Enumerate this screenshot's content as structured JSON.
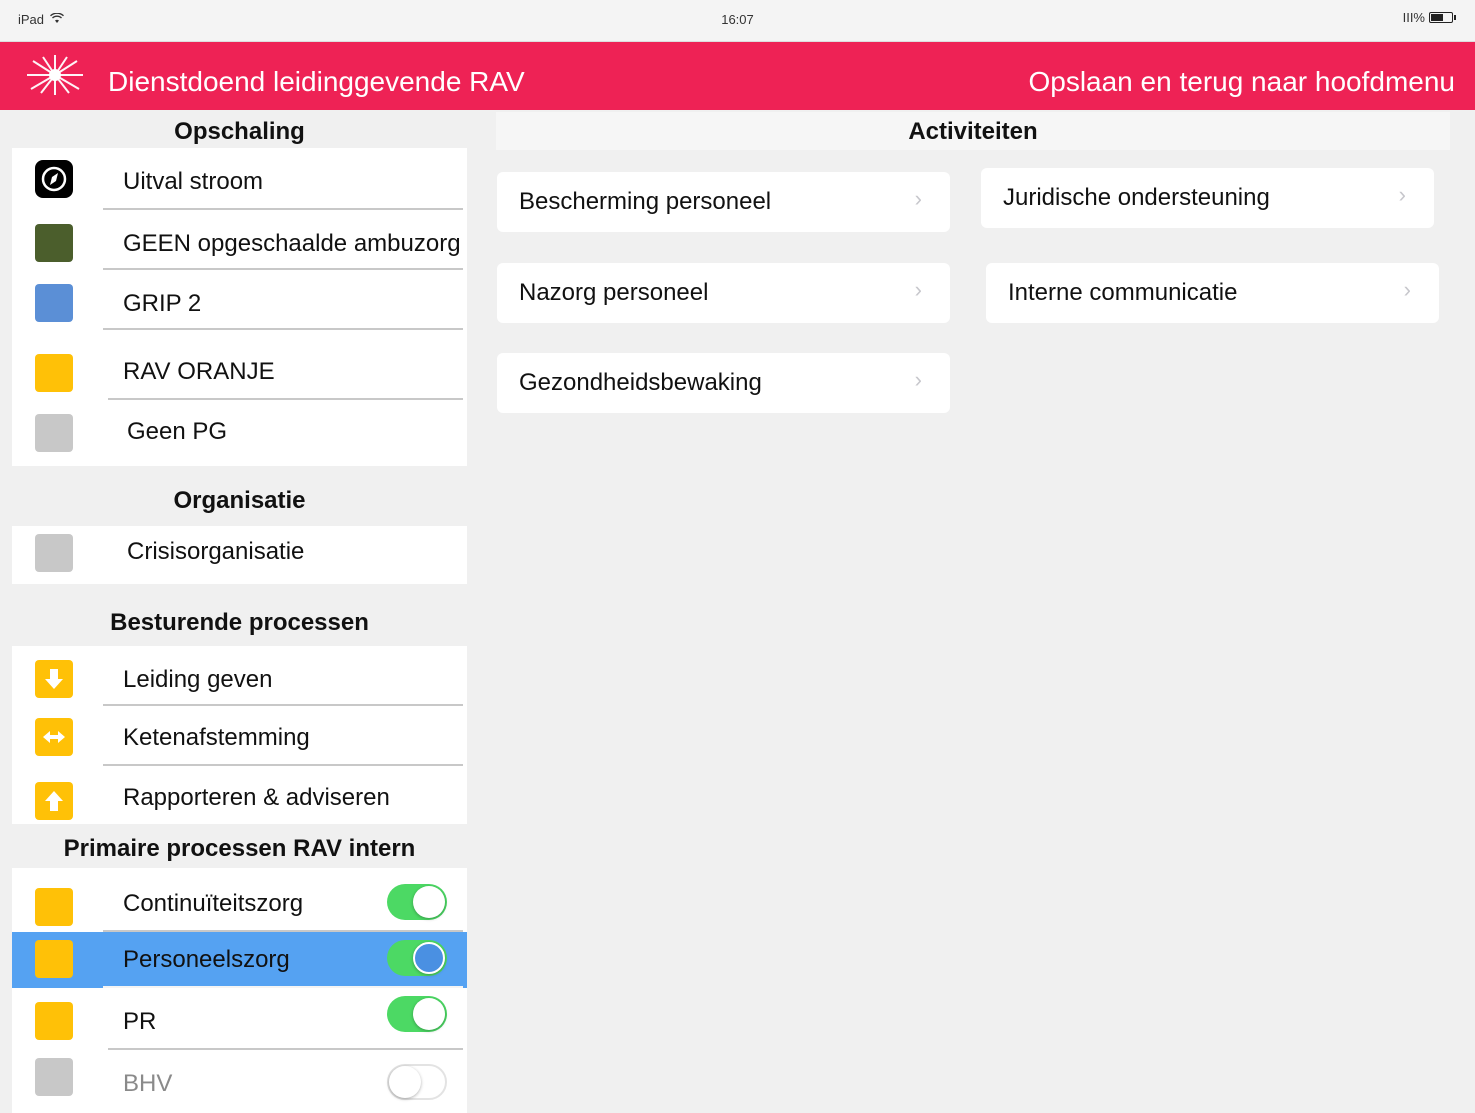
{
  "status_bar": {
    "device": "iPad",
    "wifi_icon": "wifi-icon",
    "time": "16:07",
    "battery_text": "III%",
    "battery_level": 0.6
  },
  "header": {
    "title": "Dienstdoend leidinggevende RAV",
    "action": "Opslaan en terug naar hoofdmenu",
    "background": "#ee2255"
  },
  "sidebar": {
    "opschaling": {
      "title": "Opschaling",
      "items": [
        {
          "label": "Uitval stroom",
          "color": "#000000",
          "icon": "compass-icon"
        },
        {
          "label": "GEEN opgeschaalde ambuzorg",
          "color": "#4b5e2c"
        },
        {
          "label": "GRIP 2",
          "color": "#5b8fd6"
        },
        {
          "label": "RAV ORANJE",
          "color": "#ffc107"
        },
        {
          "label": "Geen PG",
          "color": "#c8c8c8"
        }
      ]
    },
    "organisatie": {
      "title": "Organisatie",
      "items": [
        {
          "label": "Crisisorganisatie",
          "color": "#c8c8c8"
        }
      ]
    },
    "besturend": {
      "title": "Besturende processen",
      "items": [
        {
          "label": "Leiding geven",
          "icon": "arrow-down-icon"
        },
        {
          "label": "Ketenafstemming",
          "icon": "arrows-horizontal-icon"
        },
        {
          "label": "Rapporteren & adviseren",
          "icon": "arrow-up-icon"
        }
      ]
    },
    "primair": {
      "title": "Primaire processen RAV intern",
      "items": [
        {
          "label": "Continuïteitszorg",
          "on": true
        },
        {
          "label": "Personeelszorg",
          "on": true,
          "selected": true
        },
        {
          "label": "PR",
          "on": true
        },
        {
          "label": "BHV",
          "on": false
        }
      ]
    }
  },
  "main": {
    "title": "Activiteiten",
    "cards": [
      {
        "label": "Bescherming personeel"
      },
      {
        "label": "Juridische ondersteuning"
      },
      {
        "label": "Nazorg personeel"
      },
      {
        "label": "Interne communicatie"
      },
      {
        "label": "Gezondheidsbewaking"
      }
    ],
    "chevron": "›"
  }
}
